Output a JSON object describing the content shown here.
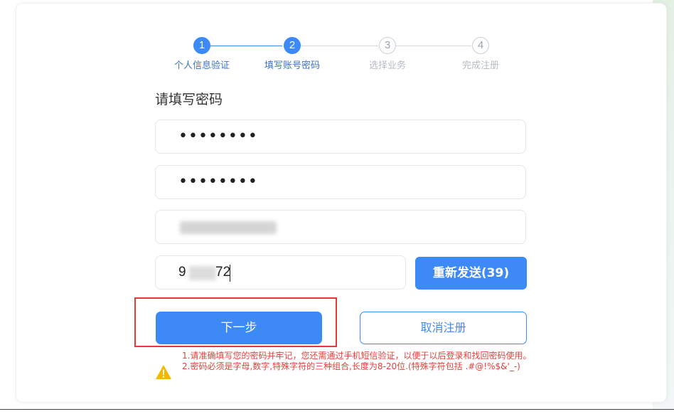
{
  "steps": [
    {
      "number": "1",
      "label": "个人信息验证",
      "state": "active"
    },
    {
      "number": "2",
      "label": "填写账号密码",
      "state": "active"
    },
    {
      "number": "3",
      "label": "选择业务",
      "state": "inactive"
    },
    {
      "number": "4",
      "label": "完成注册",
      "state": "inactive"
    }
  ],
  "form": {
    "title": "请填写密码",
    "password_masked": "••••••••",
    "confirm_password_masked": "••••••••",
    "verification_code_visible_start": "9",
    "verification_code_visible_end": "72",
    "resend_label": "重新发送(39)"
  },
  "actions": {
    "next_label": "下一步",
    "cancel_label": "取消注册"
  },
  "notes": {
    "line1": "1.请准确填写您的密码并牢记，您还需通过手机短信验证，以便于以后登录和找回密码使用。",
    "line2": "2.密码必须是字母,数字,特殊字符的三种组合,长度为8-20位.(特殊字符包括 .#@!%$&'_-)"
  },
  "colors": {
    "accent": "#3d8af7",
    "highlight_box": "#e53935",
    "warning_text": "#e8403a",
    "warning_icon": "#f5b800"
  }
}
